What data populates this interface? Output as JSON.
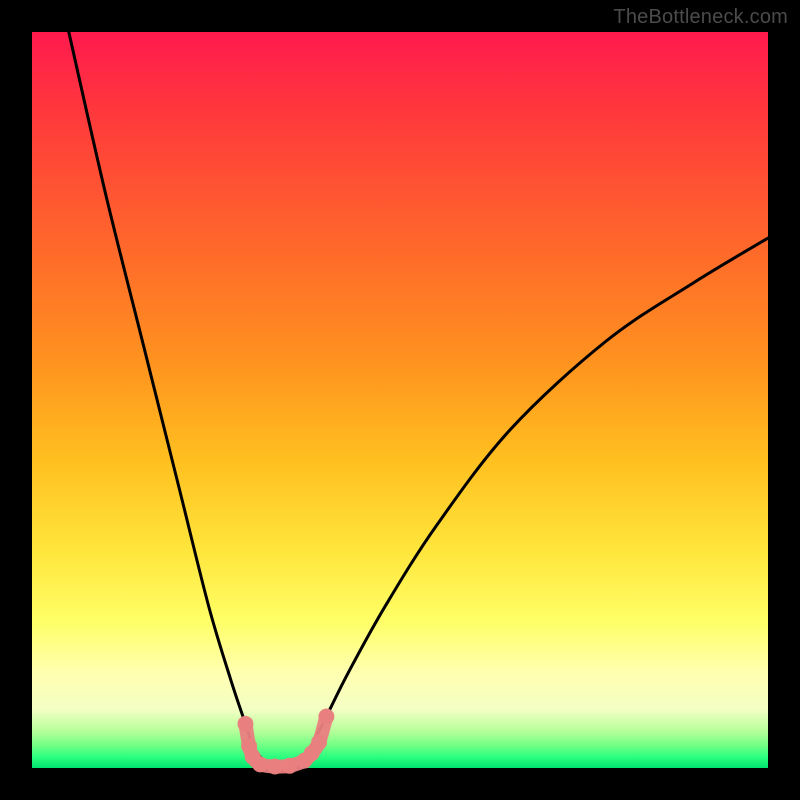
{
  "watermark": "TheBottleneck.com",
  "colors": {
    "frame": "#000000",
    "curve": "#000000",
    "markers": "#e98080",
    "gradient_top": "#ff1a4d",
    "gradient_bottom": "#00e36e"
  },
  "chart_data": {
    "type": "line",
    "title": "",
    "xlabel": "",
    "ylabel": "",
    "xlim": [
      0,
      100
    ],
    "ylim": [
      0,
      100
    ],
    "grid": false,
    "series": [
      {
        "name": "left-curve",
        "x": [
          5,
          10,
          15,
          20,
          24,
          27,
          29,
          30,
          31,
          32,
          33
        ],
        "y": [
          100,
          78,
          58,
          38,
          22,
          12,
          6,
          3,
          1.5,
          0.6,
          0
        ]
      },
      {
        "name": "right-curve",
        "x": [
          36,
          37,
          38,
          40,
          43,
          48,
          55,
          65,
          78,
          90,
          100
        ],
        "y": [
          0,
          1,
          3,
          7,
          13,
          22,
          33,
          46,
          58,
          66,
          72
        ]
      }
    ],
    "markers": [
      {
        "x": 29,
        "y": 6
      },
      {
        "x": 29.5,
        "y": 3
      },
      {
        "x": 30,
        "y": 1.5
      },
      {
        "x": 31,
        "y": 0.5
      },
      {
        "x": 33,
        "y": 0.2
      },
      {
        "x": 35,
        "y": 0.3
      },
      {
        "x": 37,
        "y": 1.0
      },
      {
        "x": 38,
        "y": 2.0
      },
      {
        "x": 39,
        "y": 3.5
      },
      {
        "x": 40,
        "y": 7
      }
    ]
  }
}
